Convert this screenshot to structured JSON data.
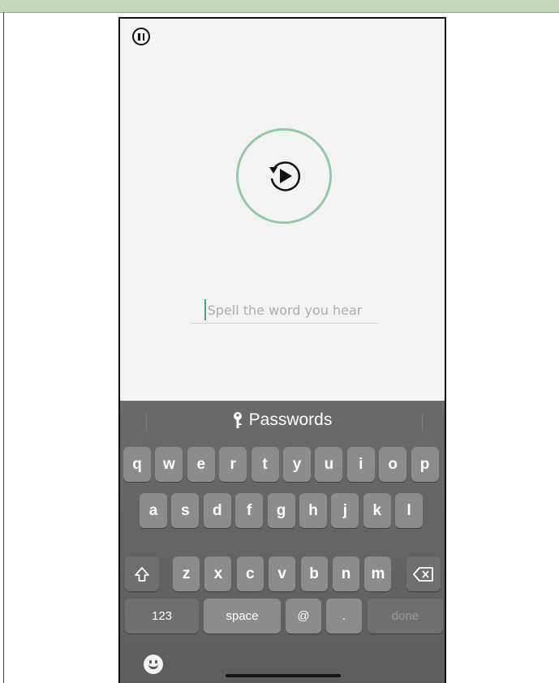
{
  "input": {
    "placeholder": "Spell the word you hear"
  },
  "keyboard": {
    "suggestion": "Passwords",
    "rows": [
      [
        "q",
        "w",
        "e",
        "r",
        "t",
        "y",
        "u",
        "i",
        "o",
        "p"
      ],
      [
        "a",
        "s",
        "d",
        "f",
        "g",
        "h",
        "j",
        "k",
        "l"
      ],
      [
        "z",
        "x",
        "c",
        "v",
        "b",
        "n",
        "m"
      ]
    ],
    "numbers_label": "123",
    "space_label": "space",
    "at_label": "@",
    "dot_label": ".",
    "done_label": "done"
  },
  "icons": {
    "pause": "pause-icon",
    "replay": "replay-play-icon",
    "key": "key-icon",
    "shift": "shift-icon",
    "backspace": "backspace-icon",
    "emoji": "emoji-icon"
  },
  "colors": {
    "ring": "#93c9a6",
    "caret": "#4aa27a",
    "keyboard_bg": "#666666",
    "key_bg": "#8c8c8c"
  }
}
